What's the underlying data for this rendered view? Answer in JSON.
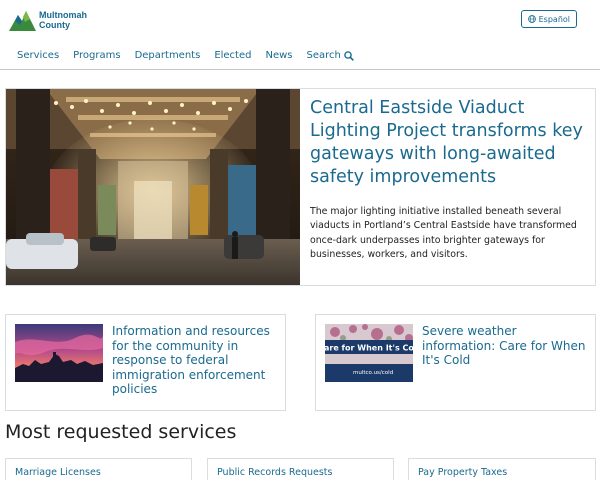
{
  "header": {
    "logo": {
      "line1": "Multnomah",
      "line2": "County",
      "icon": "mountain-logo-icon"
    },
    "language_button": {
      "label": "Español",
      "icon": "globe-icon"
    },
    "nav": [
      {
        "label": "Services"
      },
      {
        "label": "Programs"
      },
      {
        "label": "Departments"
      },
      {
        "label": "Elected"
      },
      {
        "label": "News"
      }
    ],
    "search": {
      "label": "Search",
      "icon": "search-icon"
    }
  },
  "hero": {
    "title": "Central Eastside Viaduct Lighting Project transforms key gateways with long-awaited safety improvements",
    "body": "The major lighting initiative installed beneath several viaducts in Portland’s Central Eastside have transformed once-dark underpasses into brighter gateways for businesses, workers, and visitors."
  },
  "cards": [
    {
      "title": "Information and resources for the community in response to federal immigration enforcement policies"
    },
    {
      "title": "Severe weather information: Care for When It's Cold",
      "image_text": {
        "headline": "are for When It's Co",
        "url": "multco.us/cold"
      }
    }
  ],
  "most_requested": {
    "title": "Most requested services",
    "items": [
      {
        "label": "Marriage Licenses"
      },
      {
        "label": "Public Records Requests"
      },
      {
        "label": "Pay Property Taxes"
      }
    ]
  },
  "colors": {
    "link": "#1a6a8f",
    "logo_green": "#3a8a3e",
    "border": "#d7dde0"
  }
}
